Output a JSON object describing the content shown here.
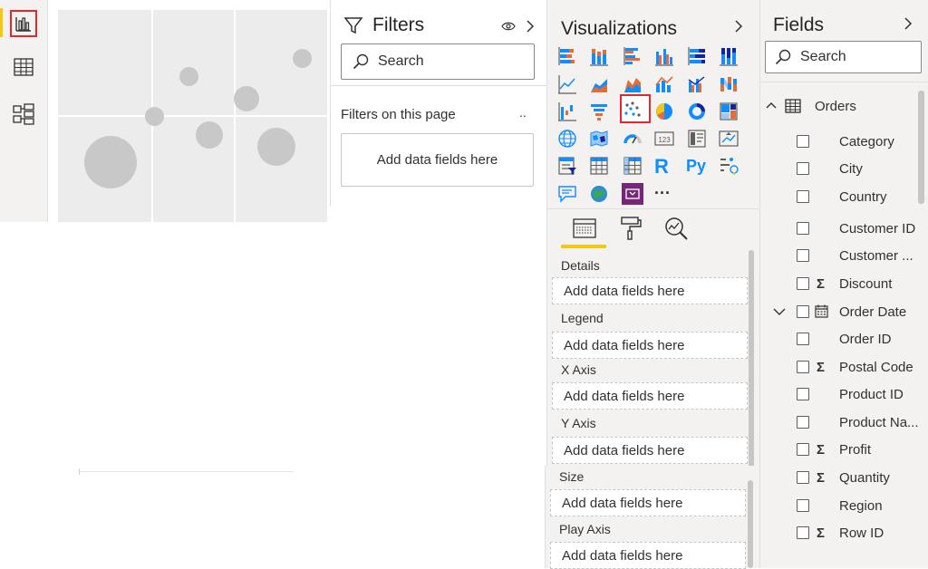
{
  "nav": {
    "items": [
      {
        "icon": "report-view-icon",
        "active": true
      },
      {
        "icon": "data-view-icon",
        "active": false
      },
      {
        "icon": "model-view-icon",
        "active": false
      }
    ],
    "accent_color": "#f2c811",
    "highlight_color": "#e3252f"
  },
  "filters": {
    "title": "Filters",
    "search_label": "Search",
    "section_label": "Filters on this page",
    "section_more": "..",
    "add_fields_label": "Add data fields here"
  },
  "visualizations": {
    "title": "Visualizations",
    "more_label": "...",
    "selected_icon": "scatter-chart-icon",
    "icon_rows": [
      [
        "stacked-bar-chart-icon",
        "stacked-column-chart-icon",
        "clustered-bar-chart-icon",
        "clustered-column-chart-icon",
        "100-stacked-bar-chart-icon",
        "100-stacked-column-chart-icon"
      ],
      [
        "line-chart-icon",
        "area-chart-icon",
        "stacked-area-chart-icon",
        "line-and-stacked-column-chart-icon",
        "line-and-clustered-column-chart-icon",
        "ribbon-chart-icon"
      ],
      [
        "waterfall-chart-icon",
        "funnel-icon",
        "scatter-chart-icon",
        "pie-chart-icon",
        "donut-chart-icon",
        "treemap-icon"
      ],
      [
        "map-icon",
        "filled-map-icon",
        "gauge-icon",
        "card-icon",
        "multi-row-card-icon",
        "kpi-icon"
      ],
      [
        "slicer-icon",
        "table-icon",
        "matrix-icon",
        "r-script-icon",
        "python-visual-icon",
        "key-influencers-icon"
      ],
      [
        "qa-icon",
        "arcgis-map-icon",
        "power-apps-icon",
        "more-visuals-icon"
      ]
    ],
    "r_label": "R",
    "py_label": "Py",
    "card_label": "123",
    "wells": [
      {
        "label": "Details",
        "placeholder": "Add data fields here"
      },
      {
        "label": "Legend",
        "placeholder": "Add data fields here"
      },
      {
        "label": "X Axis",
        "placeholder": "Add data fields here"
      },
      {
        "label": "Y Axis",
        "placeholder": "Add data fields here"
      },
      {
        "label": "Size",
        "placeholder": "Add data fields here"
      },
      {
        "label": "Play Axis",
        "placeholder": "Add data fields here"
      }
    ],
    "tab_icons": [
      "fields-tab-icon",
      "format-paint-roller-icon",
      "analytics-magnifier-icon"
    ],
    "active_tab_color": "#f2c811"
  },
  "fields": {
    "title": "Fields",
    "search_label": "Search",
    "table_name": "Orders",
    "items": [
      {
        "name": "Category",
        "sigma": false,
        "icon": null
      },
      {
        "name": "City",
        "sigma": false,
        "icon": null
      },
      {
        "name": "Country",
        "sigma": false,
        "icon": null
      },
      {
        "name": "Customer ID",
        "sigma": false,
        "icon": null
      },
      {
        "name": "Customer ...",
        "sigma": false,
        "icon": null
      },
      {
        "name": "Discount",
        "sigma": true,
        "icon": null
      },
      {
        "name": "Order Date",
        "sigma": false,
        "icon": "calendar-icon"
      },
      {
        "name": "Order ID",
        "sigma": false,
        "icon": null
      },
      {
        "name": "Postal Code",
        "sigma": true,
        "icon": null
      },
      {
        "name": "Product ID",
        "sigma": false,
        "icon": null
      },
      {
        "name": "Product Na...",
        "sigma": false,
        "icon": null
      },
      {
        "name": "Profit",
        "sigma": true,
        "icon": null
      },
      {
        "name": "Quantity",
        "sigma": true,
        "icon": null
      },
      {
        "name": "Region",
        "sigma": false,
        "icon": null
      },
      {
        "name": "Row ID",
        "sigma": true,
        "icon": null
      }
    ],
    "sigma_glyph": "Σ"
  }
}
